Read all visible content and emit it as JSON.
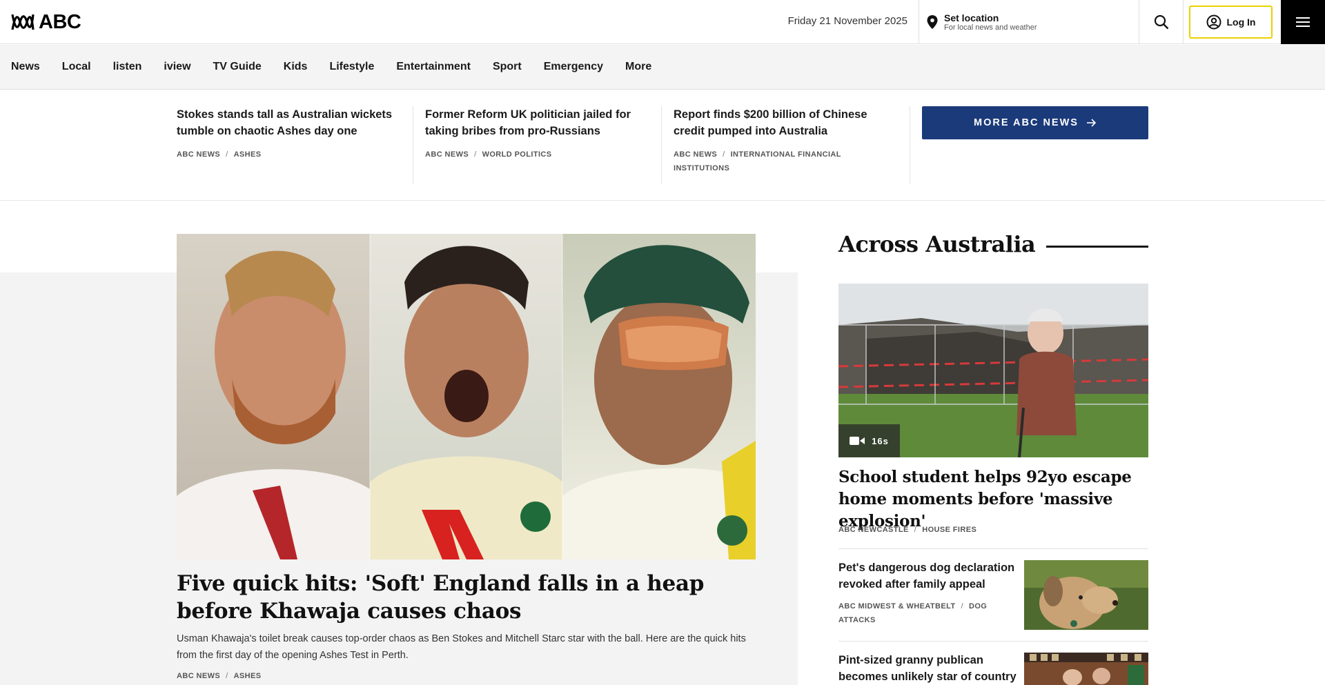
{
  "header": {
    "logo_text": "ABC",
    "date": "Friday 21 November 2025",
    "location_title": "Set location",
    "location_sub": "For local news and weather",
    "login_label": "Log In"
  },
  "nav": [
    "News",
    "Local",
    "listen",
    "iview",
    "TV Guide",
    "Kids",
    "Lifestyle",
    "Entertainment",
    "Sport",
    "Emergency",
    "More"
  ],
  "top_stories": [
    {
      "title": "Stokes stands tall as Australian wickets tumble on chaotic Ashes day one",
      "source": "ABC NEWS",
      "topic": "ASHES"
    },
    {
      "title": "Former Reform UK politician jailed for taking bribes from pro-Russians",
      "source": "ABC NEWS",
      "topic": "WORLD POLITICS"
    },
    {
      "title": "Report finds $200 billion of Chinese credit pumped into Australia",
      "source": "ABC NEWS",
      "topic": "INTERNATIONAL FINANCIAL INSTITUTIONS"
    }
  ],
  "more_button": "MORE ABC NEWS",
  "hero": {
    "title": "Five quick hits: 'Soft' England falls in a heap before Khawaja causes chaos",
    "description": "Usman Khawaja's toilet break causes top-order chaos as Ben Stokes and Mitchell Starc star with the ball. Here are the quick hits from the first day of the opening Ashes Test in Perth.",
    "source": "ABC NEWS",
    "topic": "ASHES"
  },
  "sidebar": {
    "heading": "Across Australia",
    "feature": {
      "video_duration": "16s",
      "title": "School student helps 92yo escape home moments before 'massive explosion'",
      "source": "ABC NEWCASTLE",
      "topic": "HOUSE FIRES"
    },
    "items": [
      {
        "title": "Pet's dangerous dog declaration revoked after family appeal",
        "source": "ABC MIDWEST & WHEATBELT",
        "topic": "DOG ATTACKS"
      },
      {
        "title": "Pint-sized granny publican becomes unlikely star of country",
        "source": "",
        "topic": ""
      }
    ]
  },
  "colors": {
    "more_button_bg": "#1b3a7a",
    "login_border": "#e8d200",
    "menu_bg": "#000000"
  }
}
